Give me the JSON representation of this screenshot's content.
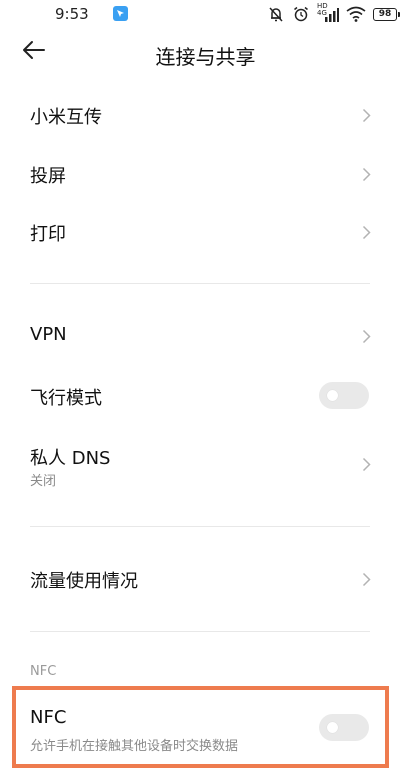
{
  "status_bar": {
    "time": "9:53",
    "network_label": "HD 4G",
    "battery": "98"
  },
  "header": {
    "title": "连接与共享"
  },
  "group1": [
    {
      "label": "小米互传"
    },
    {
      "label": "投屏"
    },
    {
      "label": "打印"
    }
  ],
  "group2": {
    "vpn": {
      "label": "VPN"
    },
    "airplane": {
      "label": "飞行模式",
      "enabled": false
    },
    "private_dns": {
      "label": "私人 DNS",
      "status": "关闭"
    }
  },
  "group3": {
    "data_usage": {
      "label": "流量使用情况"
    }
  },
  "nfc_section": {
    "header": "NFC",
    "nfc": {
      "label": "NFC",
      "description": "允许手机在接触其他设备时交换数据",
      "enabled": false
    }
  },
  "colors": {
    "highlight_border": "#ee7b4e",
    "toggle_off": "#e9e9e9",
    "secondary_text": "#8a8a8a"
  }
}
